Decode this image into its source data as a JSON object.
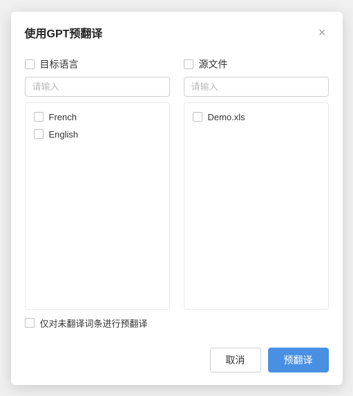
{
  "dialog": {
    "title": "使用GPT预翻译",
    "close_icon": "×"
  },
  "left_column": {
    "header_checkbox": false,
    "header_label": "目标语言",
    "search_placeholder": "请输入",
    "items": [
      {
        "label": "French",
        "checked": false
      },
      {
        "label": "English",
        "checked": false
      }
    ]
  },
  "right_column": {
    "header_checkbox": false,
    "header_label": "源文件",
    "search_placeholder": "请输入",
    "items": [
      {
        "label": "Demo.xls",
        "checked": false
      }
    ]
  },
  "footer_option": {
    "checkbox": false,
    "label": "仅对未翻译词条进行预翻译"
  },
  "buttons": {
    "cancel": "取消",
    "confirm": "预翻译"
  }
}
